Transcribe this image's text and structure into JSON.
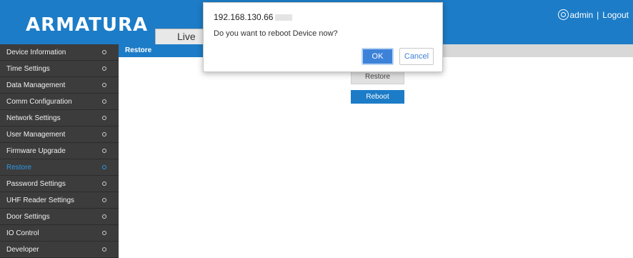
{
  "header": {
    "logo": "ARMATURA",
    "tab_live": "Live",
    "user": "admin",
    "separator": "|",
    "logout": "Logout"
  },
  "sidebar": {
    "items": [
      {
        "label": "Device Information"
      },
      {
        "label": "Time Settings"
      },
      {
        "label": "Data Management"
      },
      {
        "label": "Comm Configuration"
      },
      {
        "label": "Network Settings"
      },
      {
        "label": "User Management"
      },
      {
        "label": "Firmware Upgrade"
      },
      {
        "label": "Restore",
        "active": true
      },
      {
        "label": "Password Settings"
      },
      {
        "label": "UHF Reader Settings"
      },
      {
        "label": "Door Settings"
      },
      {
        "label": "IO Control"
      },
      {
        "label": "Developer"
      }
    ]
  },
  "content": {
    "title": "Restore",
    "restore_button": "Restore",
    "reboot_button": "Reboot"
  },
  "dialog": {
    "title": "192.168.130.66",
    "message": "Do you want to reboot Device now?",
    "ok": "OK",
    "cancel": "Cancel"
  },
  "colors": {
    "header_bg": "#1c7cc7",
    "sidebar_bg": "#3c3c3c",
    "active_item": "#2a9ae6",
    "ok_button": "#3c82d9"
  }
}
